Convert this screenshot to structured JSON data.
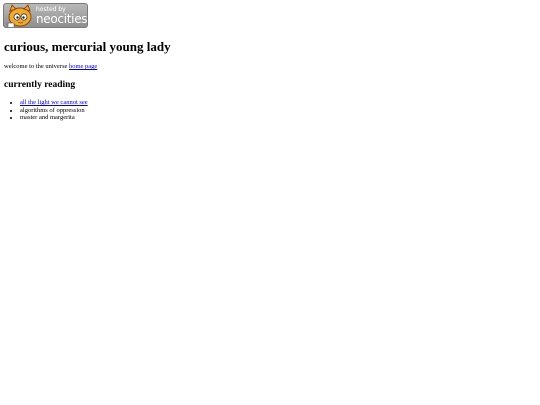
{
  "badge": {
    "hosted_text": "hosted by",
    "brand_text": "neocities"
  },
  "title": "curious, mercurial young lady",
  "welcome": {
    "text": "welcome to the universe ",
    "link_label": "home page"
  },
  "reading": {
    "heading": "currently reading",
    "items": [
      {
        "label": "all the light we cannot see",
        "link": true
      },
      {
        "label": "algorithms of oppression",
        "link": false
      },
      {
        "label": "master and margerita",
        "link": false
      }
    ]
  },
  "colors": {
    "link": "#0000ee",
    "badge_bg": "#a6a6a6",
    "text": "#000000"
  }
}
